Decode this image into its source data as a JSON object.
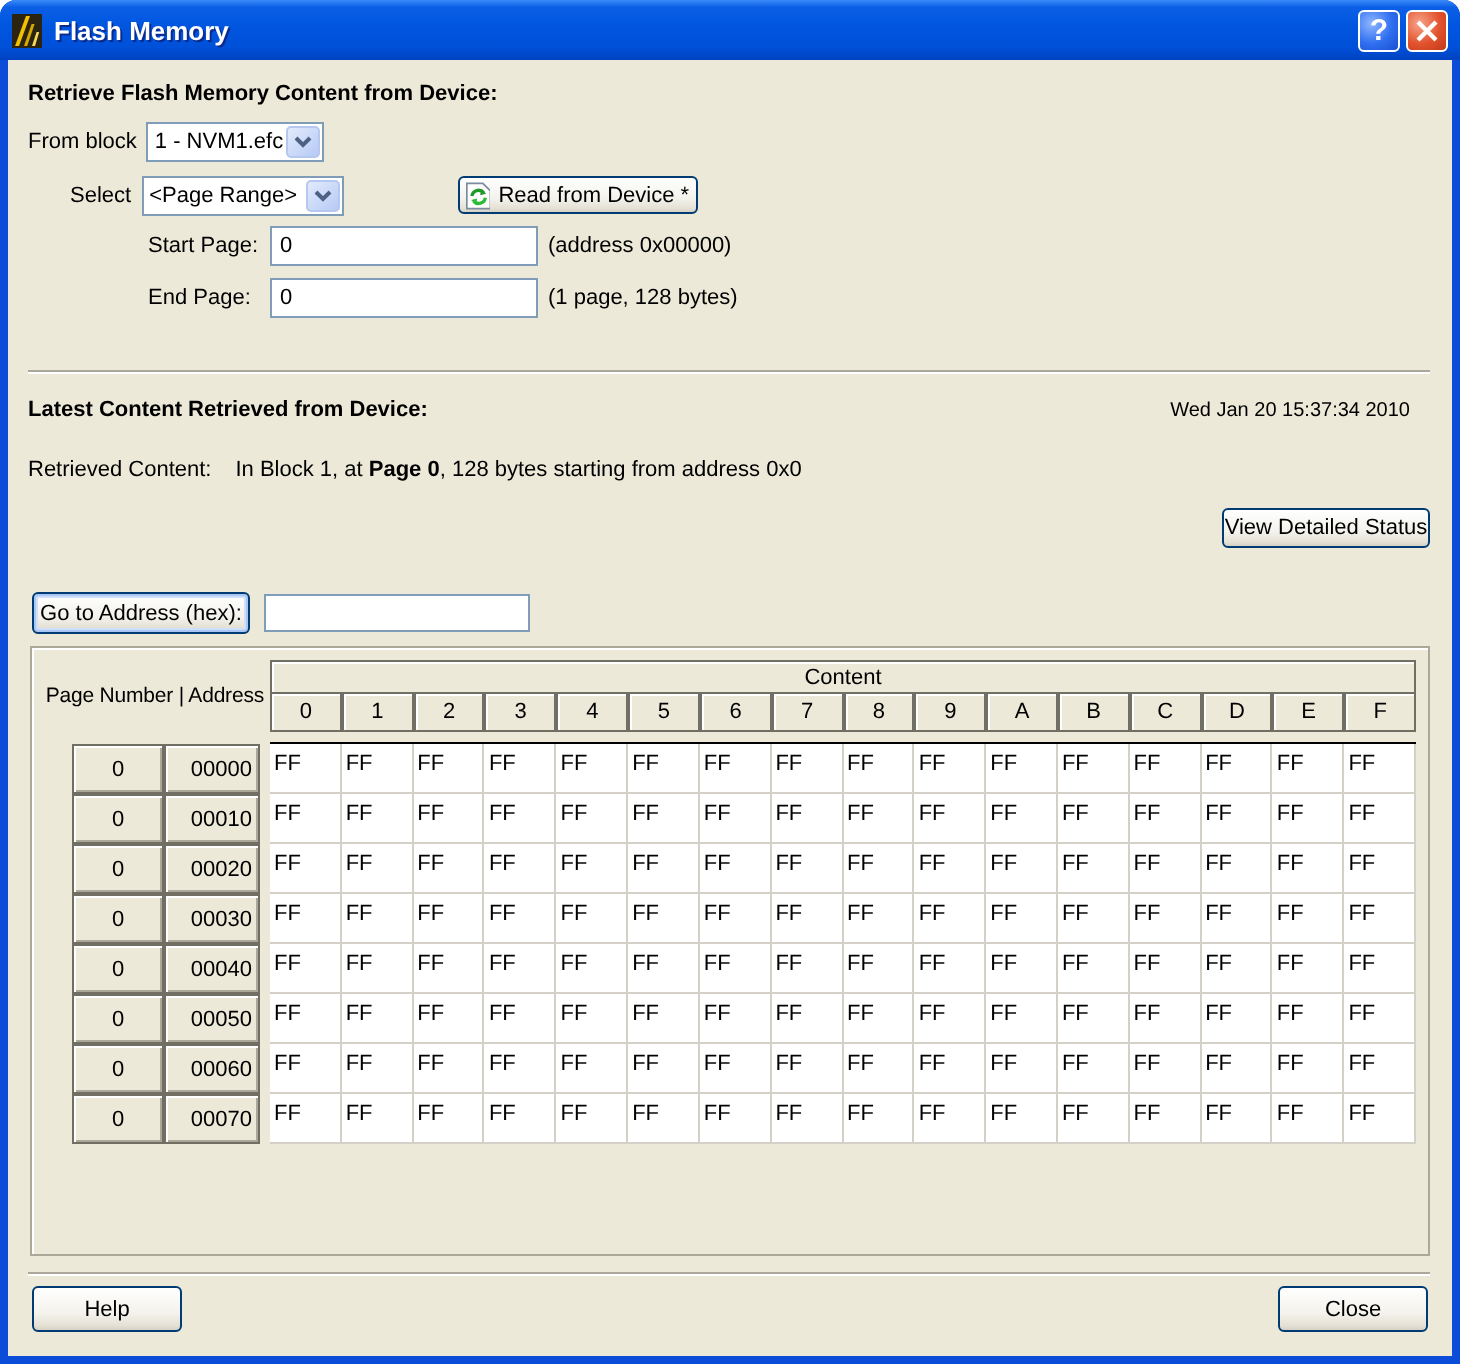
{
  "window": {
    "title": "Flash Memory",
    "help_glyph": "?"
  },
  "retrieve": {
    "heading": "Retrieve Flash Memory Content from Device:",
    "from_block": {
      "label": "From block",
      "value": "1 - NVM1.efc"
    },
    "select": {
      "label": "Select",
      "value": "<Page Range>"
    },
    "read_button": "Read from Device *",
    "start_page": {
      "label": "Start Page:",
      "value": "0",
      "note": "(address 0x00000)"
    },
    "end_page": {
      "label": "End Page:",
      "value": "0",
      "note": "(1 page, 128 bytes)"
    }
  },
  "latest": {
    "heading": "Latest Content Retrieved from Device:",
    "timestamp": "Wed Jan 20 15:37:34 2010",
    "retrieved_label": "Retrieved Content:",
    "retrieved_text": "In Block 1, at **Page 0**, 128 bytes starting from address 0x0",
    "status_button": "View Detailed Status"
  },
  "go_to_address": {
    "button": "Go to Address (hex):"
  },
  "table": {
    "corner_label": "Page Number | Address",
    "group_header": "Content",
    "columns": [
      "0",
      "1",
      "2",
      "3",
      "4",
      "5",
      "6",
      "7",
      "8",
      "9",
      "A",
      "B",
      "C",
      "D",
      "E",
      "F"
    ],
    "rows": [
      {
        "page": "0",
        "address": "00000",
        "cells": [
          "FF",
          "FF",
          "FF",
          "FF",
          "FF",
          "FF",
          "FF",
          "FF",
          "FF",
          "FF",
          "FF",
          "FF",
          "FF",
          "FF",
          "FF",
          "FF"
        ]
      },
      {
        "page": "0",
        "address": "00010",
        "cells": [
          "FF",
          "FF",
          "FF",
          "FF",
          "FF",
          "FF",
          "FF",
          "FF",
          "FF",
          "FF",
          "FF",
          "FF",
          "FF",
          "FF",
          "FF",
          "FF"
        ]
      },
      {
        "page": "0",
        "address": "00020",
        "cells": [
          "FF",
          "FF",
          "FF",
          "FF",
          "FF",
          "FF",
          "FF",
          "FF",
          "FF",
          "FF",
          "FF",
          "FF",
          "FF",
          "FF",
          "FF",
          "FF"
        ]
      },
      {
        "page": "0",
        "address": "00030",
        "cells": [
          "FF",
          "FF",
          "FF",
          "FF",
          "FF",
          "FF",
          "FF",
          "FF",
          "FF",
          "FF",
          "FF",
          "FF",
          "FF",
          "FF",
          "FF",
          "FF"
        ]
      },
      {
        "page": "0",
        "address": "00040",
        "cells": [
          "FF",
          "FF",
          "FF",
          "FF",
          "FF",
          "FF",
          "FF",
          "FF",
          "FF",
          "FF",
          "FF",
          "FF",
          "FF",
          "FF",
          "FF",
          "FF"
        ]
      },
      {
        "page": "0",
        "address": "00050",
        "cells": [
          "FF",
          "FF",
          "FF",
          "FF",
          "FF",
          "FF",
          "FF",
          "FF",
          "FF",
          "FF",
          "FF",
          "FF",
          "FF",
          "FF",
          "FF",
          "FF"
        ]
      },
      {
        "page": "0",
        "address": "00060",
        "cells": [
          "FF",
          "FF",
          "FF",
          "FF",
          "FF",
          "FF",
          "FF",
          "FF",
          "FF",
          "FF",
          "FF",
          "FF",
          "FF",
          "FF",
          "FF",
          "FF"
        ]
      },
      {
        "page": "0",
        "address": "00070",
        "cells": [
          "FF",
          "FF",
          "FF",
          "FF",
          "FF",
          "FF",
          "FF",
          "FF",
          "FF",
          "FF",
          "FF",
          "FF",
          "FF",
          "FF",
          "FF",
          "FF"
        ]
      }
    ]
  },
  "footer": {
    "help_button": "Help",
    "close_button": "Close"
  }
}
